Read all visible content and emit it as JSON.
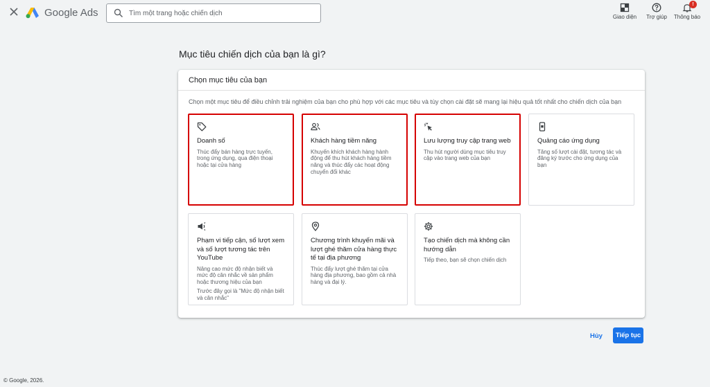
{
  "header": {
    "brand": "Google Ads",
    "search_placeholder": "Tìm một trang hoặc chiến dịch",
    "tools": {
      "appearance": "Giao diện",
      "help": "Trợ giúp",
      "notifications": "Thông báo",
      "notifications_badge": "!"
    }
  },
  "page": {
    "title": "Mục tiêu chiến dịch của bạn là gì?",
    "panel_title": "Chọn mục tiêu của bạn",
    "panel_desc": "Chọn một mục tiêu để điều chỉnh trải nghiệm của bạn cho phù hợp với các mục tiêu và tùy chọn cài đặt sẽ mang lại hiệu quả tốt nhất cho chiến dịch của bạn"
  },
  "goals": [
    {
      "icon": "tag-icon",
      "title": "Doanh số",
      "desc": "Thúc đẩy bán hàng trực tuyến, trong ứng dụng, qua điện thoại hoặc tại cửa hàng",
      "selected": true
    },
    {
      "icon": "people-icon",
      "title": "Khách hàng tiềm năng",
      "desc": "Khuyến khích khách hàng hành động để thu hút khách hàng tiềm năng và thúc đẩy các hoạt động chuyển đổi khác",
      "selected": true
    },
    {
      "icon": "cursor-click-icon",
      "title": "Lưu lượng truy cập trang web",
      "desc": "Thu hút người dùng mục tiêu truy cập vào trang web của bạn",
      "selected": true
    },
    {
      "icon": "phone-app-icon",
      "title": "Quảng cáo ứng dụng",
      "desc": "Tăng số lượt cài đặt, tương tác và đăng ký trước cho ứng dụng của bạn",
      "selected": false
    },
    {
      "icon": "megaphone-icon",
      "title": "Phạm vi tiếp cận, số lượt xem và số lượt tương tác trên YouTube",
      "desc": "Nâng cao mức độ nhận biết và mức độ cân nhắc về sản phẩm hoặc thương hiệu của bạn",
      "note": "Trước đây gọi là \"Mức độ nhận biết và cân nhắc\"",
      "selected": false
    },
    {
      "icon": "location-pin-icon",
      "title": "Chương trình khuyến mãi và lượt ghé thăm cửa hàng thực tế tại địa phương",
      "desc": "Thúc đẩy lượt ghé thăm tại cửa hàng địa phương, bao gồm cả nhà hàng và đại lý.",
      "selected": false
    },
    {
      "icon": "gear-icon",
      "title": "Tạo chiến dịch mà không cần hướng dẫn",
      "desc": "Tiếp theo, bạn sẽ chọn chiến dịch",
      "selected": false
    }
  ],
  "footer": {
    "cancel": "Hủy",
    "continue": "Tiếp tục",
    "copyright": "© Google, 2026."
  },
  "colors": {
    "accent": "#1a73e8",
    "selected_border": "#d50000",
    "badge": "#d93025"
  }
}
